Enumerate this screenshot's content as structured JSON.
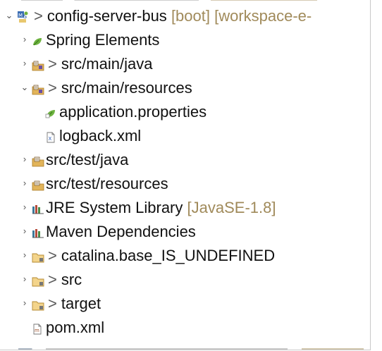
{
  "tree": {
    "items": [
      {
        "toggle": "⌄",
        "decoration": ">",
        "label": "config-server-bus",
        "qualifier": "[boot]  [workspace-e-",
        "icon": "project-icon"
      },
      {
        "toggle": "›",
        "decoration": "",
        "label": "Spring Elements",
        "qualifier": "",
        "icon": "spring-leaf-icon"
      },
      {
        "toggle": "›",
        "decoration": ">",
        "label": "src/main/java",
        "qualifier": "",
        "icon": "source-folder-icon"
      },
      {
        "toggle": "⌄",
        "decoration": ">",
        "label": "src/main/resources",
        "qualifier": "",
        "icon": "source-folder-icon"
      },
      {
        "toggle": "",
        "decoration": "",
        "label": "application.properties",
        "qualifier": "",
        "icon": "spring-properties-icon"
      },
      {
        "toggle": "",
        "decoration": "",
        "label": "logback.xml",
        "qualifier": "",
        "icon": "xml-file-icon"
      },
      {
        "toggle": "›",
        "decoration": "",
        "label": "src/test/java",
        "qualifier": "",
        "icon": "package-folder-icon"
      },
      {
        "toggle": "›",
        "decoration": "",
        "label": "src/test/resources",
        "qualifier": "",
        "icon": "package-folder-icon"
      },
      {
        "toggle": "›",
        "decoration": "",
        "label": "JRE System Library",
        "qualifier": "[JavaSE-1.8]",
        "icon": "library-icon"
      },
      {
        "toggle": "›",
        "decoration": "",
        "label": "Maven Dependencies",
        "qualifier": "",
        "icon": "library-icon"
      },
      {
        "toggle": "›",
        "decoration": ">",
        "label": "catalina.base_IS_UNDEFINED",
        "qualifier": "",
        "icon": "folder-icon"
      },
      {
        "toggle": "›",
        "decoration": ">",
        "label": "src",
        "qualifier": "",
        "icon": "folder-icon"
      },
      {
        "toggle": "›",
        "decoration": ">",
        "label": "target",
        "qualifier": "",
        "icon": "folder-icon"
      },
      {
        "toggle": "",
        "decoration": "",
        "label": "pom.xml",
        "qualifier": "",
        "icon": "maven-pom-icon"
      }
    ]
  },
  "colors": {
    "qualifier": "#a08a5a",
    "decoration": "#5b5b5b",
    "text": "#111111"
  }
}
